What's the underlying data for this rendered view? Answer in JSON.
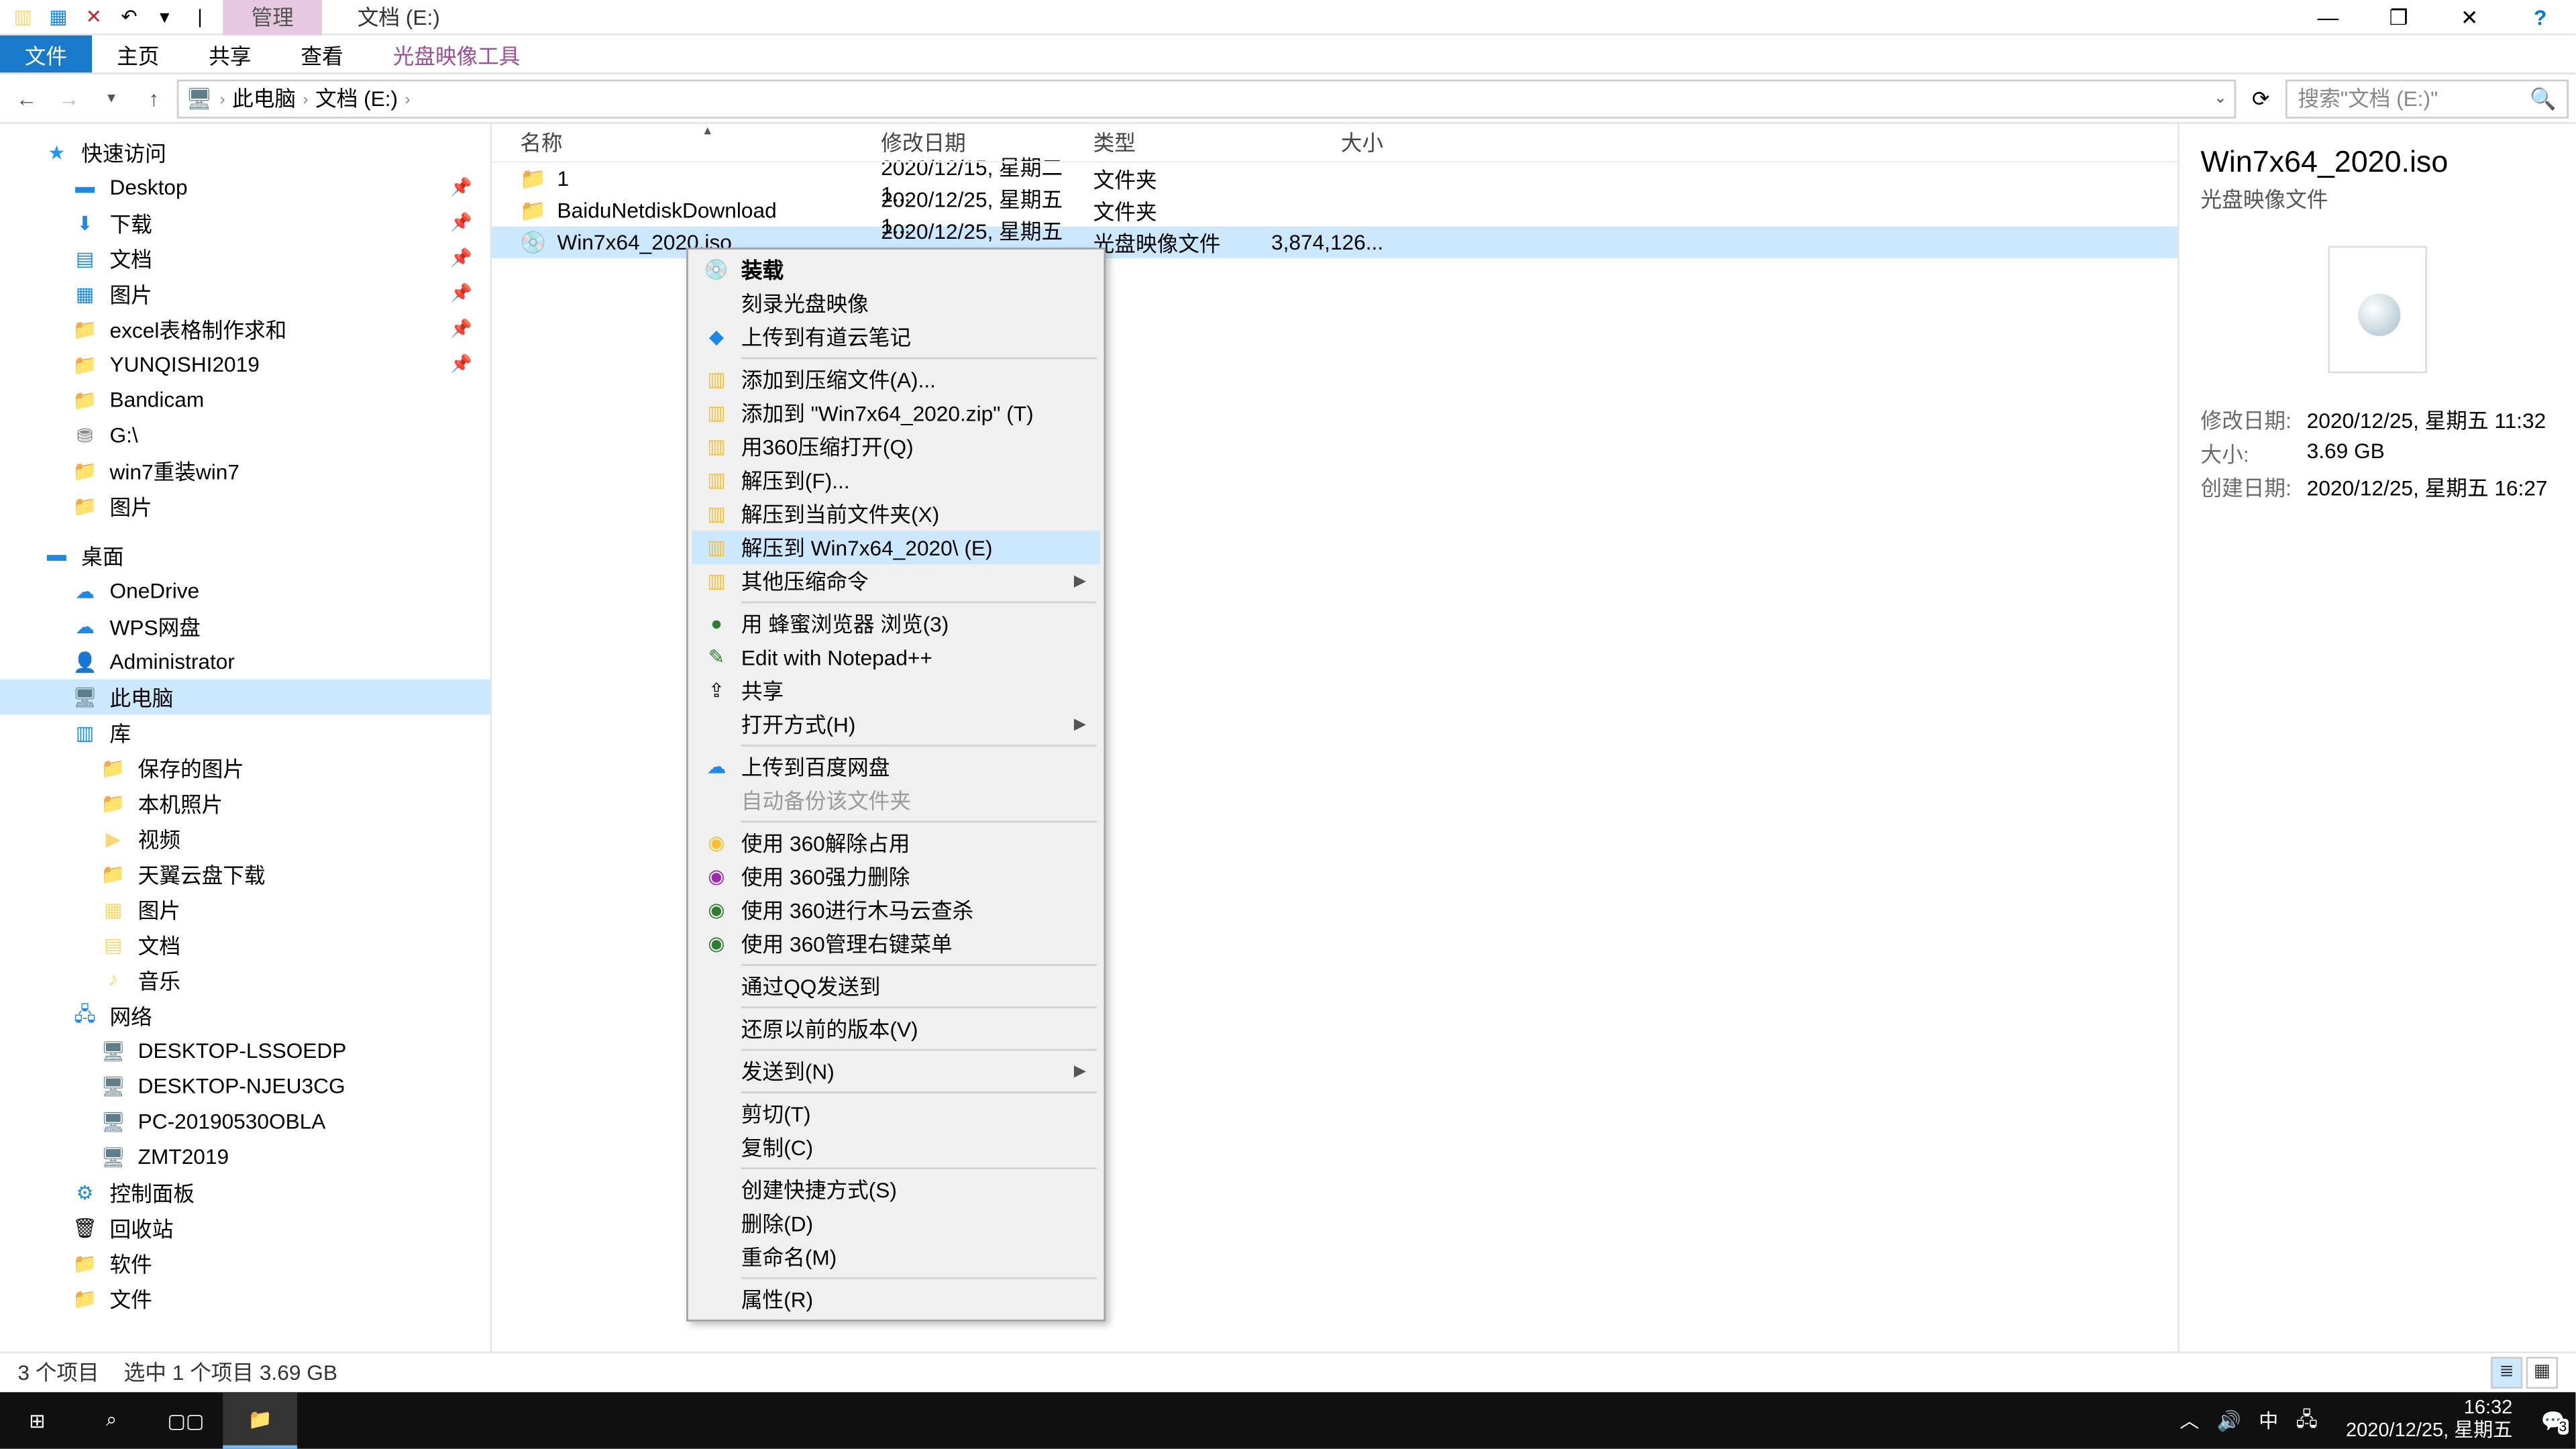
{
  "titlebar": {
    "context_tab": "管理",
    "title": "文档 (E:)",
    "minimize": "—",
    "maximize": "❐",
    "close": "✕",
    "help": "?"
  },
  "ribbon": {
    "file": "文件",
    "home": "主页",
    "share": "共享",
    "view": "查看",
    "disc_tools": "光盘映像工具"
  },
  "address": {
    "crumb_pc": "此电脑",
    "crumb_drive": "文档 (E:)",
    "search_placeholder": "搜索\"文档 (E:)\""
  },
  "columns": {
    "name": "名称",
    "date": "修改日期",
    "type": "类型",
    "size": "大小"
  },
  "rows": [
    {
      "name": "1",
      "date": "2020/12/15, 星期二 1...",
      "type": "文件夹",
      "size": ""
    },
    {
      "name": "BaiduNetdiskDownload",
      "date": "2020/12/25, 星期五 1...",
      "type": "文件夹",
      "size": ""
    },
    {
      "name": "Win7x64_2020.iso",
      "date": "2020/12/25, 星期五 1...",
      "type": "光盘映像文件",
      "size": "3,874,126..."
    }
  ],
  "nav": {
    "quick": "快速访问",
    "desktop": "Desktop",
    "downloads": "下载",
    "documents": "文档",
    "pictures": "图片",
    "excel": "excel表格制作求和",
    "yunqishi": "YUNQISHI2019",
    "bandicam": "Bandicam",
    "g_drive": "G:\\",
    "win7": "win7重装win7",
    "pics2": "图片",
    "desktop2": "桌面",
    "onedrive": "OneDrive",
    "wps": "WPS网盘",
    "admin": "Administrator",
    "thispc": "此电脑",
    "libraries": "库",
    "saved_pics": "保存的图片",
    "local_pics": "本机照片",
    "videos": "视频",
    "tianyi": "天翼云盘下载",
    "pics3": "图片",
    "docs": "文档",
    "music": "音乐",
    "network": "网络",
    "pc1": "DESKTOP-LSSOEDP",
    "pc2": "DESKTOP-NJEU3CG",
    "pc3": "PC-20190530OBLA",
    "pc4": "ZMT2019",
    "ctrlpanel": "控制面板",
    "recycle": "回收站",
    "soft": "软件",
    "files": "文件"
  },
  "preview": {
    "title": "Win7x64_2020.iso",
    "type": "光盘映像文件",
    "mod_label": "修改日期:",
    "mod_value": "2020/12/25, 星期五 11:32",
    "size_label": "大小:",
    "size_value": "3.69 GB",
    "create_label": "创建日期:",
    "create_value": "2020/12/25, 星期五 16:27"
  },
  "status": {
    "count": "3 个项目",
    "selected": "选中 1 个项目  3.69 GB"
  },
  "context": {
    "mount": "装载",
    "burn": "刻录光盘映像",
    "youdao": "上传到有道云笔记",
    "add_archive": "添加到压缩文件(A)...",
    "add_zip": "添加到 \"Win7x64_2020.zip\" (T)",
    "open_360zip": "用360压缩打开(Q)",
    "extract_to": "解压到(F)...",
    "extract_here": "解压到当前文件夹(X)",
    "extract_named": "解压到 Win7x64_2020\\ (E)",
    "other_zip": "其他压缩命令",
    "bee_browser": "用 蜂蜜浏览器 浏览(3)",
    "notepad": "Edit with Notepad++",
    "share": "共享",
    "open_with": "打开方式(H)",
    "baidu": "上传到百度网盘",
    "auto_backup": "自动备份该文件夹",
    "rel_360": "使用 360解除占用",
    "del_360": "使用 360强力删除",
    "scan_360": "使用 360进行木马云查杀",
    "menu_360": "使用 360管理右键菜单",
    "qq_send": "通过QQ发送到",
    "restore": "还原以前的版本(V)",
    "send_to": "发送到(N)",
    "cut": "剪切(T)",
    "copy": "复制(C)",
    "shortcut": "创建快捷方式(S)",
    "delete": "删除(D)",
    "rename": "重命名(M)",
    "properties": "属性(R)"
  },
  "taskbar": {
    "time": "16:32",
    "date": "2020/12/25, 星期五",
    "ime": "中",
    "notif_count": "3"
  }
}
